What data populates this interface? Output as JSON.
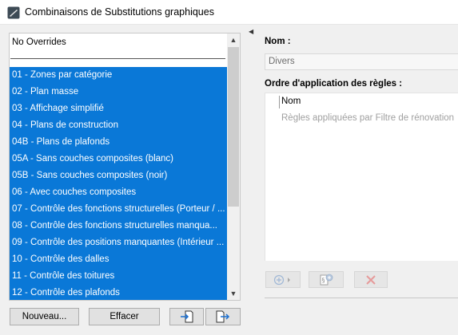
{
  "window": {
    "title": "Combinaisons de Substitutions graphiques"
  },
  "list": {
    "no_overrides": "No Overrides",
    "items": [
      "01 - Zones par catégorie",
      "02 - Plan masse",
      "03 - Affichage simplifié",
      "04 - Plans de construction",
      "04B - Plans de plafonds",
      "05A - Sans couches composites (blanc)",
      "05B - Sans couches composites (noir)",
      "06 - Avec couches composites",
      "07 - Contrôle des fonctions structurelles (Porteur / ...",
      "08 - Contrôle des fonctions structurelles manqua...",
      "09 - Contrôle des positions manquantes (Intérieur ...",
      "10 - Contrôle des dalles",
      "11 - Contrôle des toitures",
      "12 - Contrôle des plafonds"
    ],
    "selection_color": "#0a78d7"
  },
  "buttons": {
    "new_label": "Nouveau...",
    "delete_label": "Effacer",
    "import_icon": "import-icon",
    "export_icon": "export-icon"
  },
  "details": {
    "name_label": "Nom :",
    "name_value": "Divers",
    "order_label": "Ordre d'application des règles :",
    "rules_header": "Nom",
    "rules_rows": [
      "Règles appliquées par Filtre de rénovation"
    ],
    "toolbar_icons": [
      "add-rule-icon",
      "duplicate-rule-icon",
      "remove-rule-icon"
    ]
  }
}
